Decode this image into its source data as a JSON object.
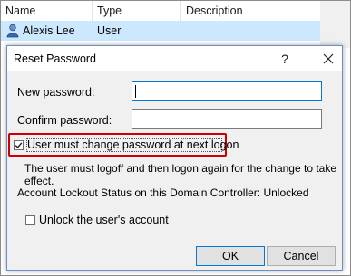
{
  "list": {
    "columns": [
      "Name",
      "Type",
      "Description"
    ],
    "row": {
      "name": "Alexis Lee",
      "type": "User",
      "description": ""
    }
  },
  "dialog": {
    "title": "Reset Password",
    "help_glyph": "?",
    "new_password_label": "New password:",
    "new_password_value": "",
    "confirm_password_label": "Confirm password:",
    "confirm_password_value": "",
    "must_change_label": "User must change password at next logon",
    "must_change_checked": true,
    "must_change_info": "The user must logoff and then logon again for the change to take effect.",
    "lockout_status": "Account Lockout Status on this Domain Controller: Unlocked",
    "unlock_label": "Unlock the user's account",
    "unlock_checked": false,
    "ok_label": "OK",
    "cancel_label": "Cancel"
  },
  "colors": {
    "selection": "#cce8ff",
    "accent": "#0078d7",
    "highlight_box": "#cc0000",
    "dialog_bg": "#f0f0f0"
  },
  "icons": [
    "user-icon",
    "help-icon",
    "close-icon",
    "checkmark-icon"
  ]
}
